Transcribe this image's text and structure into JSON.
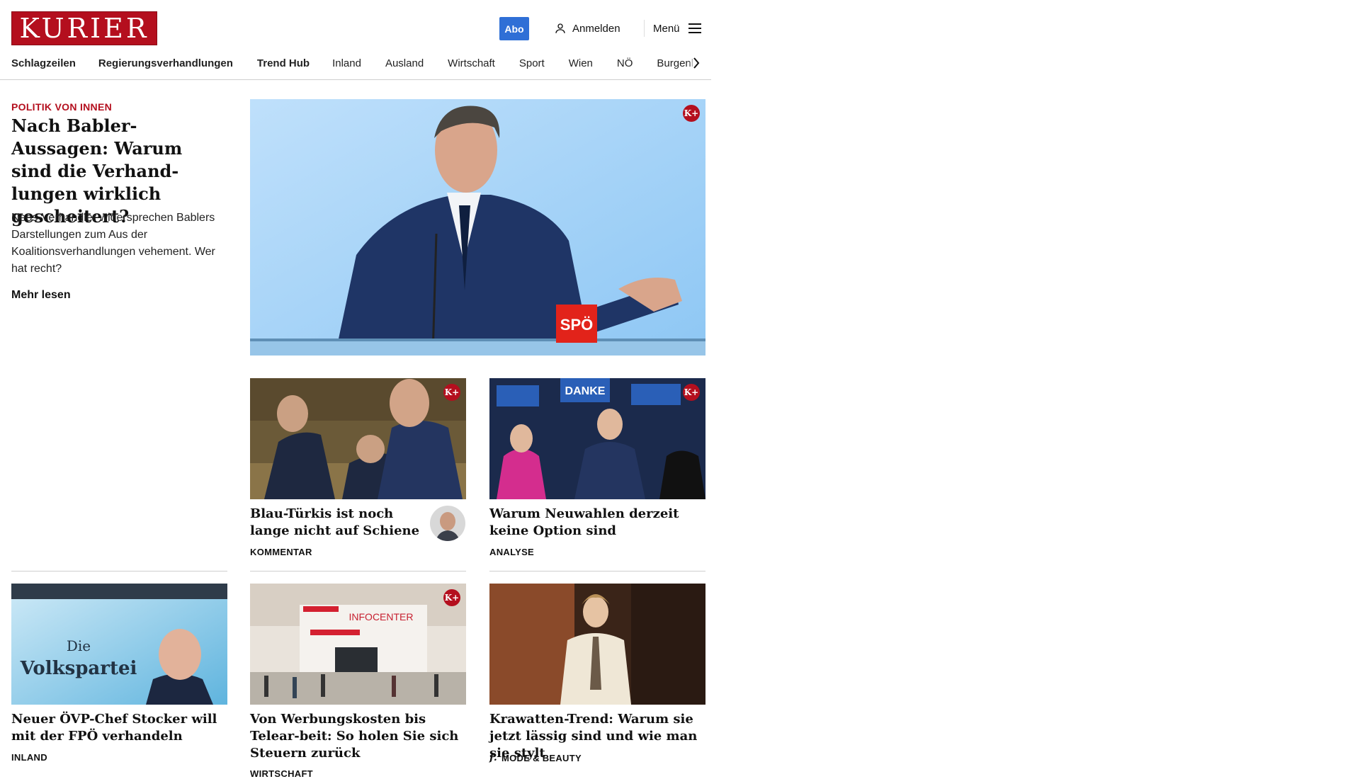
{
  "header": {
    "logo_text": "KURIER",
    "abo_label": "Abo",
    "login_label": "Anmelden",
    "menu_label": "Menü"
  },
  "nav": {
    "items": [
      "Schlagzeilen",
      "Regierungsverhandlungen",
      "Trend Hub",
      "Inland",
      "Ausland",
      "Wirtschaft",
      "Sport",
      "Wien",
      "NÖ",
      "Burgenland"
    ]
  },
  "lead": {
    "kicker": "POLITIK VON INNEN",
    "title": "Nach Babler-Aussagen: Warum sind die Verhand-lungen wirklich gescheitert?",
    "teaser": "Neos-Verhandler widersprechen Bablers Darstellungen zum Aus der Koalitionsverhandlungen vehement. Wer hat recht?",
    "more": "Mehr lesen",
    "image_badge": "K+",
    "podium_sign": "SPÖ"
  },
  "cards": [
    {
      "title": "Blau-Türkis ist noch lange nicht auf Schiene",
      "category": "KOMMENTAR",
      "badge": "K+"
    },
    {
      "title": "Warum Neuwahlen derzeit keine Option sind",
      "category": "ANALYSE",
      "badge": "K+",
      "sign_text": "DANKE"
    },
    {
      "title": "Neuer ÖVP-Chef Stocker will mit der FPÖ verhandeln",
      "category": "INLAND",
      "sign_text_1": "Die",
      "sign_text_2": "Volkspartei"
    },
    {
      "title": "Von Werbungskosten bis Telear-beit: So holen Sie sich Steuern zurück",
      "category": "WIRTSCHAFT",
      "badge": "K+",
      "sign_text": "INFOCENTER"
    },
    {
      "title": "Krawatten-Trend: Warum sie jetzt lässig sind und wie man sie stylt",
      "category": "MODE & BEAUTY",
      "category_icon": "f."
    }
  ],
  "colors": {
    "brand": "#b40f1e",
    "abo": "#2f6fd6"
  }
}
